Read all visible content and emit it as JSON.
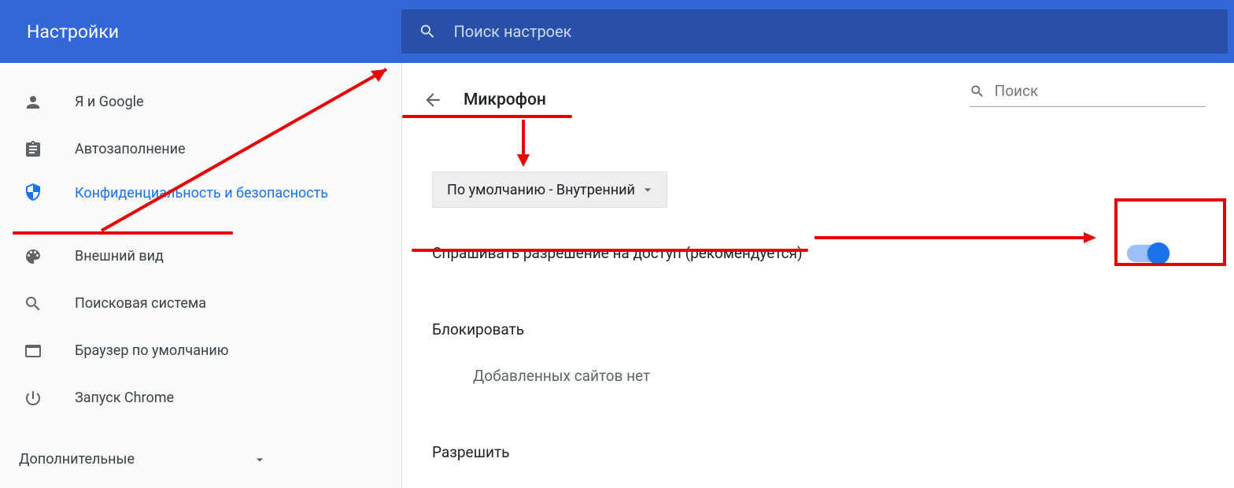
{
  "header": {
    "title": "Настройки",
    "search_placeholder": "Поиск настроек"
  },
  "sidebar": {
    "items": [
      {
        "label": "Я и Google"
      },
      {
        "label": "Автозаполнение"
      },
      {
        "label": "Конфиденциальность и безопасность"
      },
      {
        "label": "Внешний вид"
      },
      {
        "label": "Поисковая система"
      },
      {
        "label": "Браузер по умолчанию"
      },
      {
        "label": "Запуск Chrome"
      }
    ],
    "advanced_label": "Дополнительные"
  },
  "main": {
    "page_title": "Микрофон",
    "page_search_placeholder": "Поиск",
    "device_dropdown": "По умолчанию - Внутренний",
    "ask_permission_label": "Спрашивать разрешение на доступ (рекомендуется)",
    "block_heading": "Блокировать",
    "block_empty": "Добавленных сайтов нет",
    "allow_heading": "Разрешить"
  }
}
